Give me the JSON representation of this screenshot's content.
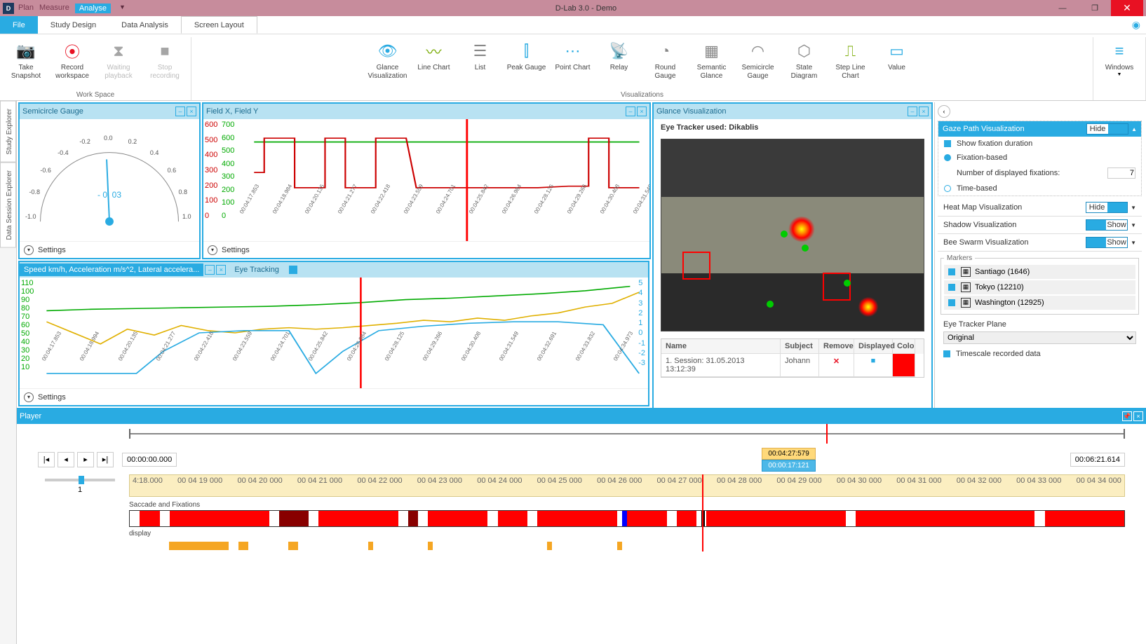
{
  "app": {
    "title": "D-Lab 3.0 - Demo",
    "logo": "D"
  },
  "qat": {
    "plan": "Plan",
    "measure": "Measure",
    "analyse": "Analyse"
  },
  "menu": {
    "file": "File",
    "study": "Study Design",
    "data": "Data Analysis",
    "screen": "Screen Layout"
  },
  "ribbon": {
    "workspace_label": "Work Space",
    "viz_label": "Visualizations",
    "snapshot": "Take Snapshot",
    "record": "Record workspace",
    "waiting": "Waiting playback",
    "stop": "Stop recording",
    "glance": "Glance Visualization",
    "line": "Line Chart",
    "list": "List",
    "peak": "Peak Gauge",
    "point": "Point Chart",
    "relay": "Relay",
    "round": "Round Gauge",
    "semglance": "Semantic Glance",
    "semi": "Semicircle Gauge",
    "state": "State Diagram",
    "step": "Step Line Chart",
    "value": "Value",
    "windows": "Windows"
  },
  "sidetabs": {
    "study": "Study Explorer",
    "session": "Data Session Explorer"
  },
  "panels": {
    "semicircle": {
      "title": "Semicircle Gauge",
      "settings": "Settings",
      "value": "- 0. 03",
      "ticks": [
        "-1.0",
        "-0.8",
        "-0.6",
        "-0.4",
        "-0.2",
        "0.0",
        "0.2",
        "0.4",
        "0.6",
        "0.8",
        "1.0"
      ]
    },
    "fieldxy": {
      "title": "Field X, Field Y",
      "settings": "Settings",
      "y_left": [
        "600",
        "500",
        "400",
        "300",
        "200",
        "100",
        "0"
      ],
      "y_right": [
        "700",
        "600",
        "500",
        "400",
        "300",
        "200",
        "100",
        "0"
      ],
      "x": [
        "00:04:17.853",
        "00:04:18.984",
        "00:04:20.135",
        "00:04:21.277",
        "00:04:22.418",
        "00:04:23.559",
        "00:04:24.701",
        "00:04:25.842",
        "00:04:26.984",
        "00:04:28.125",
        "00:04:29.266",
        "00:04:30.408",
        "00:04:31.549",
        "00:04:32.691",
        "00:04:33.832",
        "00:04:34.973"
      ]
    },
    "speed": {
      "title": "Speed km/h, Acceleration m/s^2, Lateral accelera...",
      "settings": "Settings",
      "y_left": [
        "110",
        "100",
        "90",
        "80",
        "70",
        "60",
        "50",
        "40",
        "30",
        "20",
        "10"
      ],
      "y_right": [
        "5",
        "4",
        "3",
        "2",
        "1",
        "0",
        "-1",
        "-2",
        "-3"
      ],
      "x": [
        "00:04:17.853",
        "00:04:18.994",
        "00:04:20.135",
        "00:04:21.277",
        "00:04:22.418",
        "00:04:23.559",
        "00:04:24.701",
        "00:04:25.842",
        "00:04:26.984",
        "00:04:28.125",
        "00:04:29.266",
        "00:04:30.408",
        "00:04:31.549",
        "00:04:32.691",
        "00:04:33.832",
        "00:04:34.973"
      ]
    },
    "eyetab": "Eye Tracking",
    "glance": {
      "title": "Glance Visualization",
      "subhead": "Eye Tracker used: Dikablis",
      "cols": {
        "name": "Name",
        "subject": "Subject",
        "remove": "Remove",
        "displayed": "Displayed",
        "color": "Colo"
      },
      "row": {
        "name": "1. Session: 31.05.2013 13:12:39",
        "subject": "Johann"
      }
    }
  },
  "side": {
    "gaze": {
      "title": "Gaze Path Visualization",
      "hide": "Hide",
      "show_fix": "Show fixation duration",
      "fix_based": "Fixation-based",
      "num_fix_lbl": "Number of displayed fixations:",
      "num_fix_val": "7",
      "time_based": "Time-based"
    },
    "heat": {
      "title": "Heat Map Visualization",
      "hide": "Hide"
    },
    "shadow": {
      "title": "Shadow Visualization",
      "show": "Show"
    },
    "bee": {
      "title": "Bee Swarm Visualization",
      "show": "Show"
    },
    "markers": {
      "legend": "Markers",
      "items": [
        "Santiago (1646)",
        "Tokyo (12210)",
        "Washington (12925)"
      ]
    },
    "plane": {
      "label": "Eye Tracker Plane",
      "value": "Original"
    },
    "timescale": "Timescale recorded data"
  },
  "player": {
    "title": "Player",
    "start": "00:00:00.000",
    "end": "00:06:21.614",
    "cursor_top": "00:04:27:579",
    "cursor_bot": "00:00:17:121",
    "ruler": [
      "4:18.000",
      "00 04 19 000",
      "00 04 20 000",
      "00 04 21 000",
      "00 04 22 000",
      "00 04 23 000",
      "00 04 24 000",
      "00 04 25 000",
      "00 04 26 000",
      "00 04 27 000",
      "00 04 28 000",
      "00 04 29 000",
      "00 04 30 000",
      "00 04 31 000",
      "00 04 32 000",
      "00 04 33 000",
      "00 04 34 000"
    ],
    "track1": "Saccade and Fixations",
    "track2": "display",
    "speed": "1"
  },
  "chart_data": [
    {
      "type": "gauge",
      "title": "Semicircle Gauge",
      "range": [
        -1.0,
        1.0
      ],
      "value": -0.03
    },
    {
      "type": "line",
      "title": "Field X, Field Y",
      "x": [
        "00:04:17.853",
        "00:04:18.984",
        "00:04:20.135",
        "00:04:21.277",
        "00:04:22.418",
        "00:04:23.559",
        "00:04:24.701",
        "00:04:25.842",
        "00:04:26.984",
        "00:04:28.125",
        "00:04:29.266",
        "00:04:30.408",
        "00:04:31.549",
        "00:04:32.691",
        "00:04:33.832",
        "00:04:34.973"
      ],
      "series": [
        {
          "name": "Field X",
          "color": "#c00",
          "values": [
            380,
            550,
            280,
            540,
            280,
            550,
            540,
            290,
            280,
            280,
            290,
            280,
            280,
            300,
            560,
            290
          ]
        },
        {
          "name": "Field Y",
          "color": "#0a0",
          "values": [
            560,
            560,
            560,
            560,
            560,
            560,
            560,
            560,
            560,
            560,
            560,
            560,
            560,
            560,
            560,
            560
          ]
        }
      ],
      "ylim": [
        0,
        700
      ]
    },
    {
      "type": "line",
      "title": "Speed / Acceleration / Lateral accel",
      "x": [
        "00:04:17.853",
        "00:04:18.994",
        "00:04:20.135",
        "00:04:21.277",
        "00:04:22.418",
        "00:04:23.559",
        "00:04:24.701",
        "00:04:25.842",
        "00:04:26.984",
        "00:04:28.125",
        "00:04:29.266",
        "00:04:30.408",
        "00:04:31.549",
        "00:04:32.691",
        "00:04:33.832",
        "00:04:34.973"
      ],
      "series": [
        {
          "name": "Speed km/h",
          "color": "#0a0",
          "axis": "left",
          "values": [
            78,
            80,
            81,
            82,
            82,
            83,
            84,
            85,
            86,
            88,
            90,
            92,
            94,
            96,
            100,
            105
          ]
        },
        {
          "name": "Acceleration m/s^2",
          "color": "#e0b000",
          "axis": "right",
          "values": [
            1.0,
            0.2,
            -0.5,
            0.5,
            0.0,
            0.3,
            0.1,
            0.4,
            0.2,
            0.5,
            0.8,
            0.4,
            0.6,
            0.8,
            1.2,
            2.0
          ]
        },
        {
          "name": "Lateral accel",
          "color": "#29abe2",
          "axis": "right",
          "values": [
            -2.8,
            -2.8,
            -2.8,
            -2.0,
            -1.0,
            0.0,
            0.2,
            -2.8,
            -1.0,
            0.2,
            0.4,
            0.5,
            0.5,
            0.5,
            0.3,
            -2.8
          ]
        }
      ],
      "ylim_left": [
        10,
        110
      ],
      "ylim_right": [
        -3,
        5
      ]
    }
  ]
}
